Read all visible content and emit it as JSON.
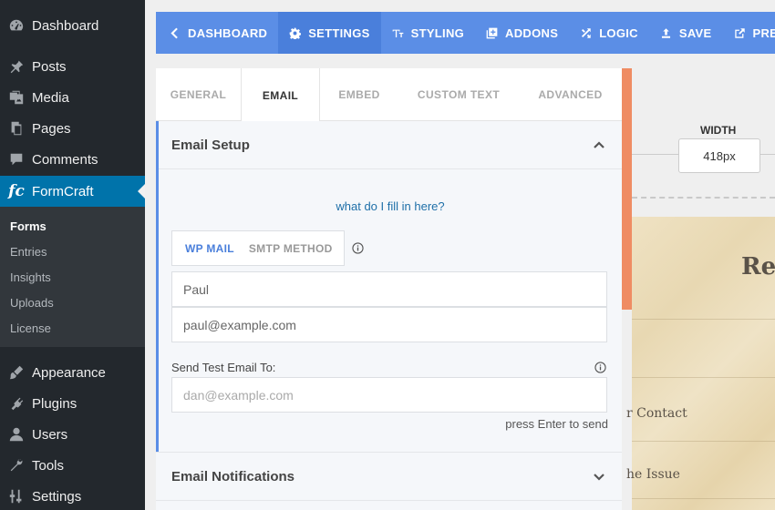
{
  "wp_menu": [
    {
      "label": "Dashboard",
      "icon": "dashboard-icon"
    },
    {
      "label": "Posts",
      "icon": "pin-icon"
    },
    {
      "label": "Media",
      "icon": "media-icon"
    },
    {
      "label": "Pages",
      "icon": "pages-icon"
    },
    {
      "label": "Comments",
      "icon": "comment-icon"
    },
    {
      "label": "FormCraft",
      "icon": "formcraft-logo-icon",
      "logo_text": "fc"
    },
    {
      "label": "Appearance",
      "icon": "brush-icon"
    },
    {
      "label": "Plugins",
      "icon": "plug-icon"
    },
    {
      "label": "Users",
      "icon": "user-icon"
    },
    {
      "label": "Tools",
      "icon": "wrench-icon"
    },
    {
      "label": "Settings",
      "icon": "sliders-icon"
    }
  ],
  "wp_submenu": [
    "Forms",
    "Entries",
    "Insights",
    "Uploads",
    "License"
  ],
  "topbar": [
    {
      "label": "Dashboard",
      "icon": "chevron-left-icon"
    },
    {
      "label": "Settings",
      "icon": "gear-icon"
    },
    {
      "label": "Styling",
      "icon": "text-size-icon"
    },
    {
      "label": "Addons",
      "icon": "plus-square-icon"
    },
    {
      "label": "Logic",
      "icon": "shuffle-icon"
    },
    {
      "label": "Save",
      "icon": "upload-icon"
    },
    {
      "label": "Preview",
      "icon": "external-link-icon"
    }
  ],
  "tabs": [
    "General",
    "Email",
    "Embed",
    "Custom Text",
    "Advanced"
  ],
  "email_setup": {
    "title": "Email Setup",
    "help_link": "what do I fill in here?",
    "methods": [
      "WP Mail",
      "SMTP Method"
    ],
    "sender_name": "Paul",
    "sender_email": "paul@example.com",
    "test_label": "Send Test Email To:",
    "test_placeholder": "dan@example.com",
    "enter_hint": "press Enter to send"
  },
  "email_notifications": {
    "title": "Email Notifications"
  },
  "preview": {
    "width_label": "WIDTH",
    "width_value": "418px",
    "title_fragment": "Re",
    "text_1": "r Contact",
    "text_2": "he Issue"
  },
  "colors": {
    "wp_sidebar": "#23282d",
    "wp_active": "#0073aa",
    "topbar": "#5b8ee6",
    "section_accent": "#5b8ee6",
    "scrollbar": "#ef8c63",
    "link": "#1e6fa8"
  }
}
